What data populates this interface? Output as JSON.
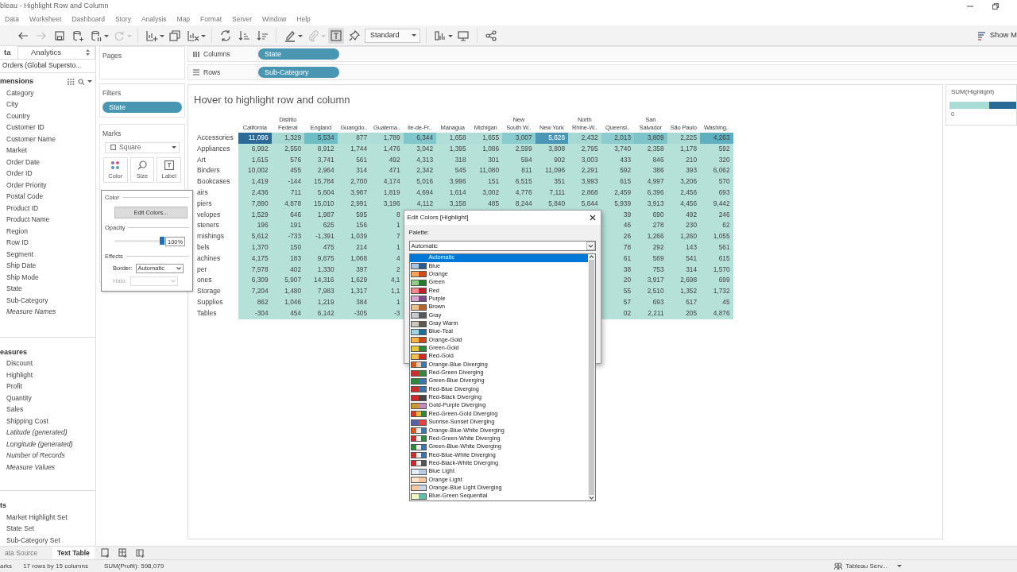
{
  "window": {
    "title": "bleau - Highlight Row and Column"
  },
  "menu": [
    "Data",
    "Worksheet",
    "Dashboard",
    "Story",
    "Analysis",
    "Map",
    "Format",
    "Server",
    "Window",
    "Help"
  ],
  "toolbar_groups": [
    {
      "items": [
        {
          "kind": "back",
          "disabled": false,
          "selected": false,
          "menu": false
        },
        {
          "kind": "forward",
          "disabled": true,
          "selected": false,
          "menu": false
        },
        {
          "kind": "save",
          "disabled": false,
          "selected": false,
          "menu": false
        },
        {
          "kind": "add-source",
          "disabled": false,
          "selected": false,
          "menu": false
        },
        {
          "kind": "pause",
          "disabled": false,
          "selected": false,
          "menu": true
        },
        {
          "kind": "refresh",
          "disabled": true,
          "selected": false,
          "menu": true
        }
      ]
    },
    {
      "items": [
        {
          "kind": "new-sheet",
          "disabled": false,
          "selected": false,
          "menu": true
        },
        {
          "kind": "duplicate",
          "disabled": false,
          "selected": false,
          "menu": false
        },
        {
          "kind": "clear",
          "disabled": false,
          "selected": false,
          "menu": true
        }
      ]
    },
    {
      "items": [
        {
          "kind": "swap",
          "disabled": false,
          "selected": false,
          "menu": false
        },
        {
          "kind": "sort-up",
          "disabled": false,
          "selected": false,
          "menu": false
        },
        {
          "kind": "sort-down",
          "disabled": false,
          "selected": false,
          "menu": false
        }
      ]
    },
    {
      "items": [
        {
          "kind": "highlight",
          "disabled": false,
          "selected": false,
          "menu": true
        },
        {
          "kind": "annotate",
          "disabled": true,
          "selected": false,
          "menu": true
        },
        {
          "kind": "labels",
          "disabled": false,
          "selected": true,
          "menu": false
        },
        {
          "kind": "pin",
          "disabled": false,
          "selected": false,
          "menu": false
        },
        {
          "kind": "dropdown",
          "value": "Standard"
        }
      ]
    },
    {
      "items": [
        {
          "kind": "cards",
          "disabled": false,
          "selected": false,
          "menu": true
        },
        {
          "kind": "present",
          "disabled": false,
          "selected": false,
          "menu": false
        }
      ]
    },
    {
      "items": [
        {
          "kind": "share",
          "disabled": false,
          "selected": false,
          "menu": false
        }
      ]
    }
  ],
  "show_me": {
    "label": "Show M"
  },
  "data_pane": {
    "tabs": [
      {
        "label": "ta",
        "selected": true
      },
      {
        "label": "Analytics",
        "selected": false
      }
    ],
    "source": "Orders (Global Supersto...",
    "sections": [
      {
        "title": "mensions",
        "tools": true,
        "fields": [
          {
            "name": "Category",
            "generated": false
          },
          {
            "name": "City",
            "generated": false
          },
          {
            "name": "Country",
            "generated": false
          },
          {
            "name": "Customer ID",
            "generated": false
          },
          {
            "name": "Customer Name",
            "generated": false
          },
          {
            "name": "Market",
            "generated": false
          },
          {
            "name": "Order Date",
            "generated": false
          },
          {
            "name": "Order ID",
            "generated": false
          },
          {
            "name": "Order Priority",
            "generated": false
          },
          {
            "name": "Postal Code",
            "generated": false
          },
          {
            "name": "Product ID",
            "generated": false
          },
          {
            "name": "Product Name",
            "generated": false
          },
          {
            "name": "Region",
            "generated": false
          },
          {
            "name": "Row ID",
            "generated": false
          },
          {
            "name": "Segment",
            "generated": false
          },
          {
            "name": "Ship Date",
            "generated": false
          },
          {
            "name": "Ship Mode",
            "generated": false
          },
          {
            "name": "State",
            "generated": false
          },
          {
            "name": "Sub-Category",
            "generated": false
          },
          {
            "name": "Measure Names",
            "generated": true
          }
        ]
      },
      {
        "title": "easures",
        "tools": false,
        "fields": [
          {
            "name": "Discount",
            "generated": false
          },
          {
            "name": "Highlight",
            "generated": false
          },
          {
            "name": "Profit",
            "generated": false
          },
          {
            "name": "Quantity",
            "generated": false
          },
          {
            "name": "Sales",
            "generated": false
          },
          {
            "name": "Shipping Cost",
            "generated": false
          },
          {
            "name": "Latitude (generated)",
            "generated": true
          },
          {
            "name": "Longitude (generated)",
            "generated": true
          },
          {
            "name": "Number of Records",
            "generated": true
          },
          {
            "name": "Measure Values",
            "generated": true
          }
        ]
      },
      {
        "title": "ts",
        "tools": false,
        "fields": [
          {
            "name": "Market Highlight Set",
            "generated": false
          },
          {
            "name": "State Set",
            "generated": false
          },
          {
            "name": "Sub-Category Set",
            "generated": false
          }
        ]
      }
    ]
  },
  "pages": {
    "title": "Pages"
  },
  "filters": {
    "title": "Filters",
    "pills": [
      "State"
    ]
  },
  "marks": {
    "title": "Marks",
    "mark_type": "Square",
    "buttons": [
      {
        "kind": "color",
        "label": "Color"
      },
      {
        "kind": "size",
        "label": "Size"
      },
      {
        "kind": "label",
        "label": "Label"
      }
    ]
  },
  "color_popup": {
    "color_heading": "Color",
    "edit_button": "Edit Colors...",
    "opacity_heading": "Opacity",
    "opacity": {
      "level": 1.0,
      "reading": "100%"
    },
    "effects_heading": "Effects",
    "border": {
      "label": "Border:",
      "value": "Automatic",
      "disabled": false
    },
    "halo": {
      "label": "Halo:",
      "disabled": true
    }
  },
  "shelves": [
    {
      "kind": "columns",
      "label": "Columns",
      "pill": "State"
    },
    {
      "kind": "rows",
      "label": "Rows",
      "pill": "Sub-Category"
    }
  ],
  "view": {
    "title": "Hover to highlight row and column",
    "columns": [
      {
        "lines": [
          "California"
        ]
      },
      {
        "lines": [
          "Distrito",
          "Federal"
        ]
      },
      {
        "lines": [
          "England"
        ]
      },
      {
        "lines": [
          "Guangdo.."
        ]
      },
      {
        "lines": [
          "Guatema.."
        ]
      },
      {
        "lines": [
          "Ile-de-Fr.."
        ]
      },
      {
        "lines": [
          "Managua"
        ]
      },
      {
        "lines": [
          "Michigan"
        ]
      },
      {
        "lines": [
          "New",
          "South W.."
        ]
      },
      {
        "lines": [
          "New York"
        ]
      },
      {
        "lines": [
          "North",
          "Rhine-W.."
        ]
      },
      {
        "lines": [
          "Queensl.."
        ]
      },
      {
        "lines": [
          "San",
          "Salvador"
        ]
      },
      {
        "lines": [
          "São Paulo"
        ]
      },
      {
        "lines": [
          "Washing.."
        ]
      }
    ],
    "rows": [
      {
        "label": "Accessories",
        "cells": [
          {
            "text": "11,096",
            "color": "#2c6b98"
          },
          {
            "text": "1,329",
            "color": "#a6d9d4"
          },
          {
            "text": "5,534",
            "color": "#6dbdc7"
          },
          {
            "text": "877",
            "color": "#b1dfd7"
          },
          {
            "text": "1,789",
            "color": "#aedcd6"
          },
          {
            "text": "6,344",
            "color": "#80c7cc"
          },
          {
            "text": "1,658",
            "color": "#b1dfd7"
          },
          {
            "text": "1,655",
            "color": "#b0ded6"
          },
          {
            "text": "3,007",
            "color": "#8acbcf"
          },
          {
            "text": "5,628",
            "color": "#4a97b5"
          },
          {
            "text": "2,432",
            "color": "#a6d8d4"
          },
          {
            "text": "2,013",
            "color": "#8ccccf"
          },
          {
            "text": "3,809",
            "color": "#7cc4ca"
          },
          {
            "text": "2,225",
            "color": "#aadad5"
          },
          {
            "text": "4,263",
            "color": "#5eafc1"
          }
        ]
      },
      {
        "label": "Appliances",
        "cells": [
          "6,992",
          "2,550",
          "8,912",
          "1,744",
          "1,476",
          "3,042",
          "1,395",
          "1,086",
          "2,599",
          "3,808",
          "2,795",
          "3,740",
          "2,358",
          "1,178",
          "592"
        ]
      },
      {
        "label": "Art",
        "cells": [
          "1,615",
          "576",
          "3,741",
          "561",
          "492",
          "4,313",
          "318",
          "301",
          "594",
          "902",
          "3,003",
          "433",
          "846",
          "210",
          "320"
        ]
      },
      {
        "label": "Binders",
        "cells": [
          "10,002",
          "455",
          "2,964",
          "314",
          "471",
          "2,342",
          "545",
          "11,080",
          "811",
          "11,096",
          "2,291",
          "592",
          "386",
          "393",
          "6,062"
        ]
      },
      {
        "label": "Bookcases",
        "cells": [
          "1,419",
          "-144",
          "15,784",
          "2,700",
          "4,174",
          "5,016",
          "3,996",
          "151",
          "6,515",
          "351",
          "3,993",
          "615",
          "4,997",
          "3,206",
          "570"
        ]
      },
      {
        "label": "airs",
        "cells": [
          "2,436",
          "711",
          "5,604",
          "3,987",
          "1,819",
          "4,694",
          "1,614",
          "3,002",
          "4,776",
          "7,111",
          "2,868",
          "2,459",
          "6,396",
          "2,456",
          "693"
        ]
      },
      {
        "label": "piers",
        "cells": [
          "7,890",
          "4,878",
          "15,010",
          "2,991",
          "3,196",
          "4,112",
          "3,158",
          "485",
          "8,244",
          "5,840",
          "5,644",
          "5,939",
          "3,913",
          "4,456",
          "9,442"
        ]
      },
      {
        "label": "velopes",
        "cells": [
          "1,529",
          "646",
          "1,987",
          "595",
          "8",
          null,
          null,
          null,
          null,
          null,
          null,
          "39",
          "690",
          "492",
          "246"
        ]
      },
      {
        "label": "steners",
        "cells": [
          "196",
          "191",
          "625",
          "156",
          "1",
          null,
          null,
          null,
          null,
          null,
          null,
          "46",
          "278",
          "230",
          "62"
        ]
      },
      {
        "label": "rnishings",
        "cells": [
          "5,612",
          "-733",
          "-1,391",
          "1,039",
          "7",
          null,
          null,
          null,
          null,
          null,
          null,
          "26",
          "1,266",
          "1,260",
          "1,055"
        ]
      },
      {
        "label": "bels",
        "cells": [
          "1,370",
          "150",
          "475",
          "214",
          "1",
          null,
          null,
          null,
          null,
          null,
          null,
          "78",
          "292",
          "143",
          "561"
        ]
      },
      {
        "label": "achines",
        "cells": [
          "4,175",
          "183",
          "9,675",
          "1,068",
          "4",
          null,
          null,
          null,
          null,
          null,
          null,
          "61",
          "569",
          "541",
          "615"
        ]
      },
      {
        "label": "per",
        "cells": [
          "7,978",
          "402",
          "1,330",
          "397",
          "2",
          null,
          null,
          null,
          null,
          null,
          null,
          "38",
          "753",
          "314",
          "1,570"
        ]
      },
      {
        "label": "ones",
        "cells": [
          "6,309",
          "5,907",
          "14,316",
          "1,629",
          "4,1",
          null,
          null,
          null,
          null,
          null,
          null,
          "20",
          "3,917",
          "2,698",
          "699"
        ]
      },
      {
        "label": "Storage",
        "cells": [
          "7,204",
          "1,480",
          "7,983",
          "1,317",
          "1,1",
          null,
          null,
          null,
          null,
          null,
          null,
          "55",
          "2,510",
          "1,352",
          "1,732"
        ]
      },
      {
        "label": "Supplies",
        "cells": [
          "862",
          "1,046",
          "1,219",
          "384",
          "1",
          null,
          null,
          null,
          null,
          null,
          null,
          "57",
          "693",
          "517",
          "45"
        ]
      },
      {
        "label": "Tables",
        "cells": [
          "-304",
          "454",
          "6,142",
          "-305",
          "-3",
          null,
          null,
          null,
          null,
          null,
          null,
          "02",
          "2,211",
          "205",
          "4,876"
        ]
      }
    ]
  },
  "dialog": {
    "title": "Edit Colors [Highlight]",
    "palette_label": "Palette:",
    "palette_value": "Automatic",
    "items": [
      {
        "label": "Automatic",
        "selected": true
      },
      {
        "label": "Blue",
        "selected": false,
        "stops": [
          {
            "color": "#a9c6e3"
          },
          {
            "color": "#2a5d8f"
          }
        ]
      },
      {
        "label": "Orange",
        "selected": false,
        "stops": [
          {
            "color": "#f8a35c"
          },
          {
            "color": "#d7471c"
          }
        ]
      },
      {
        "label": "Green",
        "selected": false,
        "stops": [
          {
            "color": "#8fcf85"
          },
          {
            "color": "#237a2f"
          }
        ]
      },
      {
        "label": "Red",
        "selected": false,
        "stops": [
          {
            "color": "#f3898a"
          },
          {
            "color": "#c21f2c"
          }
        ]
      },
      {
        "label": "Purple",
        "selected": false,
        "stops": [
          {
            "color": "#d9a5cf"
          },
          {
            "color": "#7b4b86"
          }
        ]
      },
      {
        "label": "Brown",
        "selected": false,
        "stops": [
          {
            "color": "#edc08c"
          },
          {
            "color": "#b5622c"
          }
        ]
      },
      {
        "label": "Gray",
        "selected": false,
        "stops": [
          {
            "color": "#c7cbce"
          },
          {
            "color": "#54595e"
          }
        ]
      },
      {
        "label": "Gray Warm",
        "selected": false,
        "stops": [
          {
            "color": "#cfc8c2"
          },
          {
            "color": "#5f5752"
          }
        ]
      },
      {
        "label": "Blue-Teal",
        "selected": false,
        "stops": [
          {
            "color": "#9fd3e3"
          },
          {
            "color": "#1f6f9a"
          }
        ]
      },
      {
        "label": "Orange-Gold",
        "selected": false,
        "stops": [
          {
            "color": "#f6b24b"
          },
          {
            "color": "#d0481a"
          }
        ]
      },
      {
        "label": "Green-Gold",
        "selected": false,
        "stops": [
          {
            "color": "#e6c63d"
          },
          {
            "color": "#2a8a3b"
          }
        ]
      },
      {
        "label": "Red-Gold",
        "selected": false,
        "stops": [
          {
            "color": "#f4be4b"
          },
          {
            "color": "#cf2b2b"
          }
        ]
      },
      {
        "label": "Orange-Blue Diverging",
        "selected": false,
        "stops": [
          {
            "color": "#d85a1c"
          },
          {
            "color": "#f0c9a4"
          },
          {
            "color": "#3d78b3"
          }
        ]
      },
      {
        "label": "Red-Green Diverging",
        "selected": false,
        "stops": [
          {
            "color": "#c9302c"
          },
          {
            "color": "#2e8b3e"
          }
        ]
      },
      {
        "label": "Green-Blue Diverging",
        "selected": false,
        "stops": [
          {
            "color": "#2e8b3e"
          },
          {
            "color": "#3b75b0"
          }
        ]
      },
      {
        "label": "Red-Blue Diverging",
        "selected": false,
        "stops": [
          {
            "color": "#c9302c"
          },
          {
            "color": "#3b75b0"
          }
        ]
      },
      {
        "label": "Red-Black Diverging",
        "selected": false,
        "stops": [
          {
            "color": "#d0282c"
          },
          {
            "color": "#444444"
          }
        ]
      },
      {
        "label": "Gold-Purple Diverging",
        "selected": false,
        "stops": [
          {
            "color": "#c99a2e"
          },
          {
            "color": "#c08bc2"
          }
        ]
      },
      {
        "label": "Red-Green-Gold Diverging",
        "selected": false,
        "stops": [
          {
            "color": "#d23a2a"
          },
          {
            "color": "#f0b63e"
          },
          {
            "color": "#2f8a3a"
          }
        ]
      },
      {
        "label": "Sunrise-Sunset Diverging",
        "selected": false,
        "stops": [
          {
            "color": "#5662a8"
          },
          {
            "color": "#e7413a"
          }
        ]
      },
      {
        "label": "Orange-Blue-White Diverging",
        "selected": false,
        "stops": [
          {
            "color": "#d85a1c"
          },
          {
            "color": "#f2eeea"
          },
          {
            "color": "#3d78b3"
          }
        ]
      },
      {
        "label": "Red-Green-White Diverging",
        "selected": false,
        "stops": [
          {
            "color": "#c9302c"
          },
          {
            "color": "#f2eeea"
          },
          {
            "color": "#2e8b3e"
          }
        ]
      },
      {
        "label": "Green-Blue-White Diverging",
        "selected": false,
        "stops": [
          {
            "color": "#2e8b3e"
          },
          {
            "color": "#f2eeea"
          },
          {
            "color": "#3b75b0"
          }
        ]
      },
      {
        "label": "Red-Blue-White Diverging",
        "selected": false,
        "stops": [
          {
            "color": "#c9302c"
          },
          {
            "color": "#f2eeea"
          },
          {
            "color": "#3b75b0"
          }
        ]
      },
      {
        "label": "Red-Black-White Diverging",
        "selected": false,
        "stops": [
          {
            "color": "#d0282c"
          },
          {
            "color": "#f2eeea"
          },
          {
            "color": "#555555"
          }
        ]
      },
      {
        "label": "Blue Light",
        "selected": false,
        "stops": [
          {
            "color": "#e4ecf5"
          },
          {
            "color": "#b8cde4"
          }
        ]
      },
      {
        "label": "Orange Light",
        "selected": false,
        "stops": [
          {
            "color": "#fbe3cc"
          },
          {
            "color": "#f5c6a0"
          }
        ]
      },
      {
        "label": "Orange-Blue Light Diverging",
        "selected": false,
        "stops": [
          {
            "color": "#f6c9a2"
          },
          {
            "color": "#c4d6ea"
          }
        ]
      },
      {
        "label": "Blue-Green Sequential",
        "selected": false,
        "stops": [
          {
            "color": "#f0f6c4"
          },
          {
            "color": "#5fc0b1"
          }
        ]
      }
    ]
  },
  "legend": {
    "title": "SUM(Highlight)",
    "stops": [
      {
        "color": "#a8dcd4"
      },
      {
        "color": "#2a6a97"
      }
    ],
    "min": "0"
  },
  "sheet_tabs": [
    {
      "kind": "source",
      "label": "ata Source",
      "selected": false
    },
    {
      "kind": "sheet",
      "label": "Text Table",
      "selected": true
    }
  ],
  "status": [
    "arks",
    "17 rows by 15 columns",
    "SUM(Profit): 598,079"
  ],
  "server": {
    "label": "Tableau Serv..."
  }
}
